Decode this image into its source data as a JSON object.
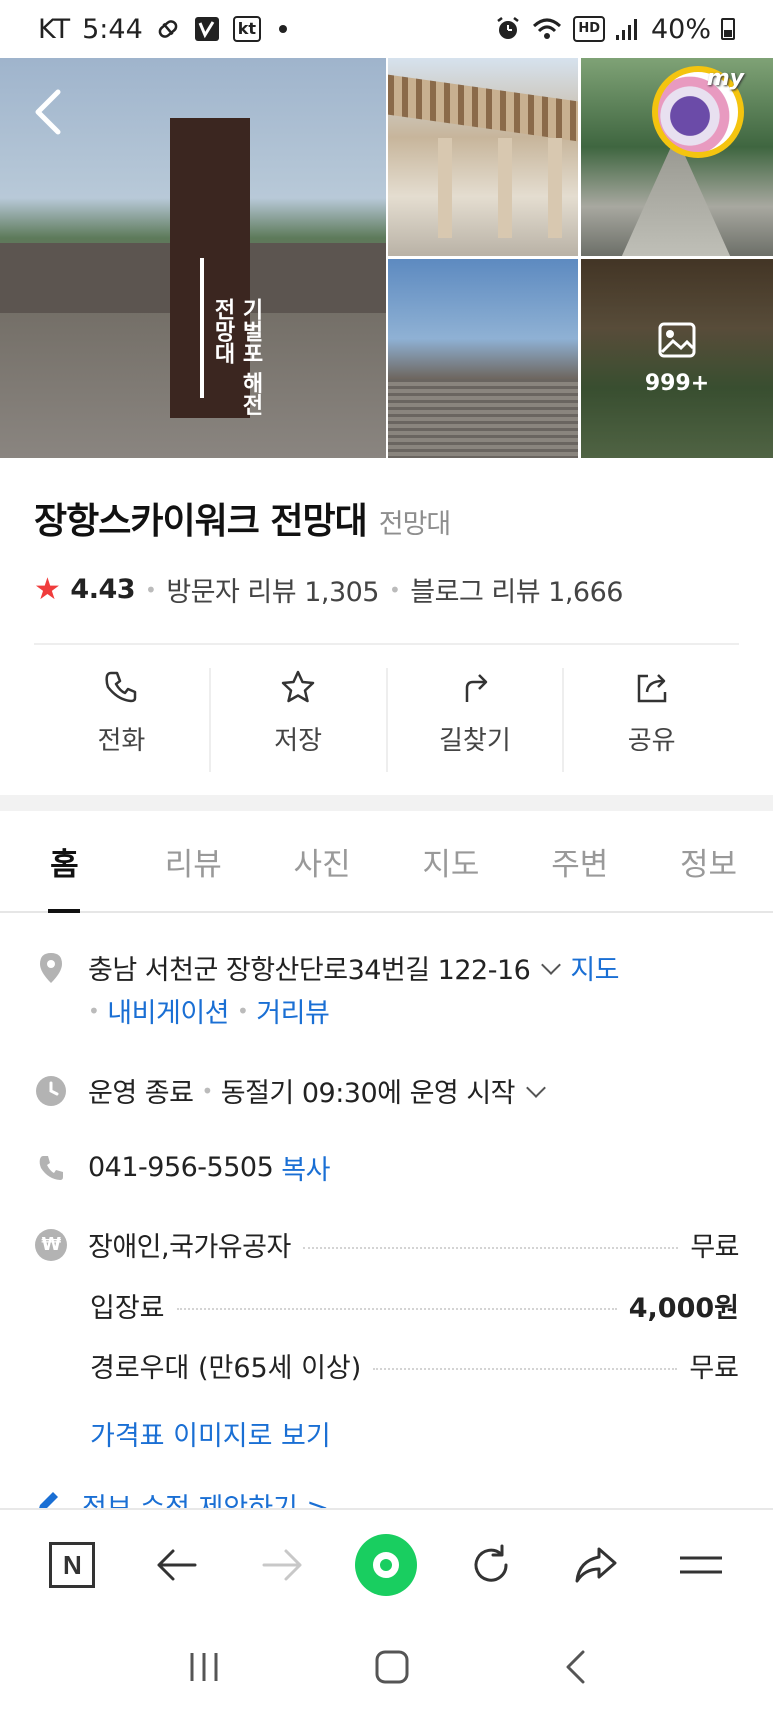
{
  "status_bar": {
    "carrier": "KT",
    "time": "5:44",
    "kt_badge": "kt",
    "battery": "40%"
  },
  "gallery": {
    "more_count": "999+",
    "profile_badge": "my",
    "monument_text": "기벌포 해전 전망대"
  },
  "place": {
    "name": "장항스카이워크 전망대",
    "category": "전망대",
    "rating": "4.43",
    "visitor_reviews": "방문자 리뷰 1,305",
    "blog_reviews": "블로그 리뷰 1,666"
  },
  "actions": [
    {
      "label": "전화",
      "icon": "phone-icon"
    },
    {
      "label": "저장",
      "icon": "star-icon"
    },
    {
      "label": "길찾기",
      "icon": "directions-icon"
    },
    {
      "label": "공유",
      "icon": "share-icon"
    }
  ],
  "tabs": [
    {
      "label": "홈",
      "active": true
    },
    {
      "label": "리뷰",
      "active": false
    },
    {
      "label": "사진",
      "active": false
    },
    {
      "label": "지도",
      "active": false
    },
    {
      "label": "주변",
      "active": false
    },
    {
      "label": "정보",
      "active": false
    }
  ],
  "info": {
    "address": "충남 서천군 장항산단로34번길 122-16",
    "map_link": "지도",
    "navigation_link": "내비게이션",
    "streetview_link": "거리뷰",
    "hours_status": "운영 종료",
    "hours_detail": "동절기 09:30에 운영 시작",
    "phone": "041-956-5505",
    "copy_link": "복사",
    "prices": [
      {
        "label": "장애인,국가유공자",
        "value": "무료",
        "bold": false
      },
      {
        "label": "입장료",
        "value": "4,000원",
        "bold": true
      },
      {
        "label": "경로우대 (만65세 이상)",
        "value": "무료",
        "bold": false
      }
    ],
    "price_image_link": "가격표 이미지로 보기",
    "suggest_edit_link": "정보 수정 제안하기 >"
  },
  "colors": {
    "link": "#1a6fd4",
    "star": "#f03c3c",
    "naver_green": "#19ce60"
  }
}
